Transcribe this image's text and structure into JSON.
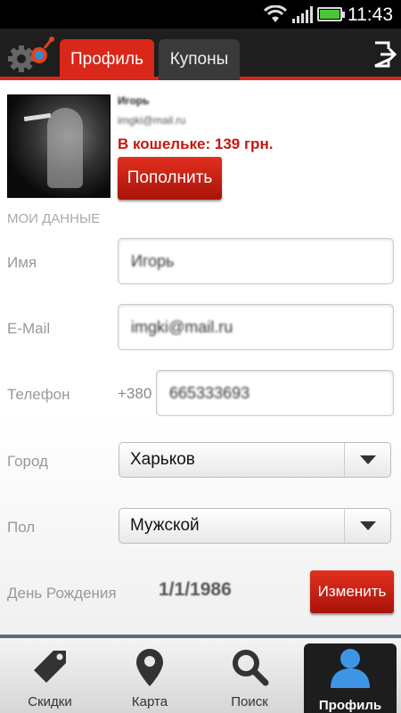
{
  "status": {
    "time": "11:43"
  },
  "tabs": {
    "profile": "Профиль",
    "coupons": "Купоны"
  },
  "user": {
    "name": "Игорь",
    "email": "imgki@mail.ru",
    "wallet": "В кошельке: 139 грн."
  },
  "buttons": {
    "topup": "Пополнить",
    "change": "Изменить"
  },
  "section_title": "МОИ ДАННЫЕ",
  "form": {
    "name_label": "Имя",
    "name_value": "Игорь",
    "email_label": "E-Mail",
    "email_value": "imgki@mail.ru",
    "phone_label": "Телефон",
    "phone_prefix": "+380",
    "phone_value": "665333693",
    "city_label": "Город",
    "city_value": "Харьков",
    "gender_label": "Пол",
    "gender_value": "Мужской",
    "birthday_label": "День Рождения",
    "birthday_value": "1/1/1986"
  },
  "nav": {
    "discounts": "Скидки",
    "map": "Карта",
    "search": "Поиск",
    "profile": "Профиль"
  },
  "colors": {
    "accent": "#d9271a",
    "dark": "#1e1e1e"
  },
  "icons": [
    "wifi-icon",
    "signal-icon",
    "battery-icon",
    "gear-logo-icon",
    "logout-icon",
    "tag-icon",
    "map-pin-icon",
    "search-icon",
    "user-icon",
    "chevron-down-icon"
  ]
}
